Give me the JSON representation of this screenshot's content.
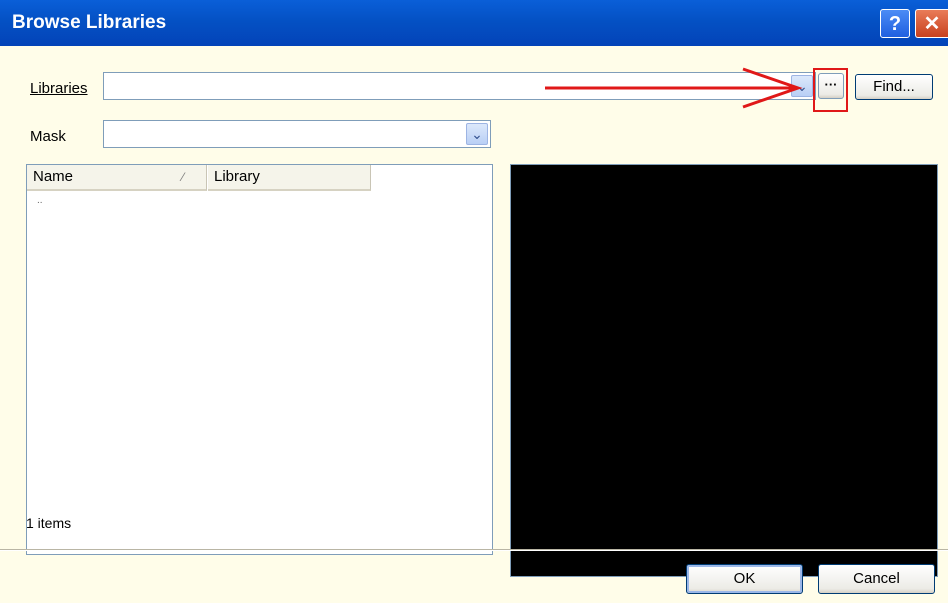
{
  "window": {
    "title": "Browse Libraries",
    "help_glyph": "?",
    "close_glyph": "✕"
  },
  "libraries": {
    "label": "Libraries",
    "value": "",
    "browse_label": "···",
    "find_label": "Find..."
  },
  "mask": {
    "label": "Mask",
    "value": ""
  },
  "list": {
    "columns": [
      "Name",
      "Library"
    ],
    "sort_glyph": "⁄",
    "rows": [
      {
        "name": "..",
        "library": ""
      }
    ],
    "status": "1 items"
  },
  "buttons": {
    "ok": "OK",
    "cancel": "Cancel"
  },
  "colors": {
    "annotation": "#e01818",
    "titlebar": "#0451c4",
    "client_bg": "#fffde9"
  }
}
